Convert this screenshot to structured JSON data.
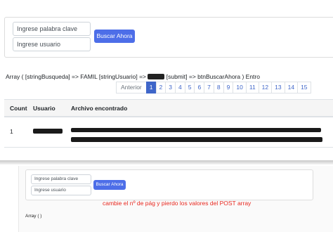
{
  "top_form": {
    "keyword_placeholder": "Ingrese palabra clave",
    "user_placeholder": "Ingrese usuario",
    "search_button": "Buscar Ahora"
  },
  "debug_output": {
    "array_prefix": "Array ( [stringBusqueda] => FAMIL [stringUsuario] => ",
    "array_suffix": " [submit] => btnBuscarAhora ) Entro"
  },
  "pagination": {
    "previous": "Anterior",
    "pages": [
      "1",
      "2",
      "3",
      "4",
      "5",
      "6",
      "7",
      "8",
      "9",
      "10",
      "11",
      "12",
      "13",
      "14",
      "15"
    ],
    "active_page": "1"
  },
  "table": {
    "headers": [
      "Count",
      "Usuario",
      "Archivo encontrado"
    ],
    "rows": [
      {
        "count": "1"
      }
    ]
  },
  "bottom_form": {
    "keyword_placeholder": "Ingrese palabra clave",
    "user_placeholder": "Ingrese usuario",
    "search_button": "Buscar Ahora"
  },
  "annotation": "cambie el nº de pág y pierdo los valores del POST array",
  "bottom_output": "Array ( )"
}
